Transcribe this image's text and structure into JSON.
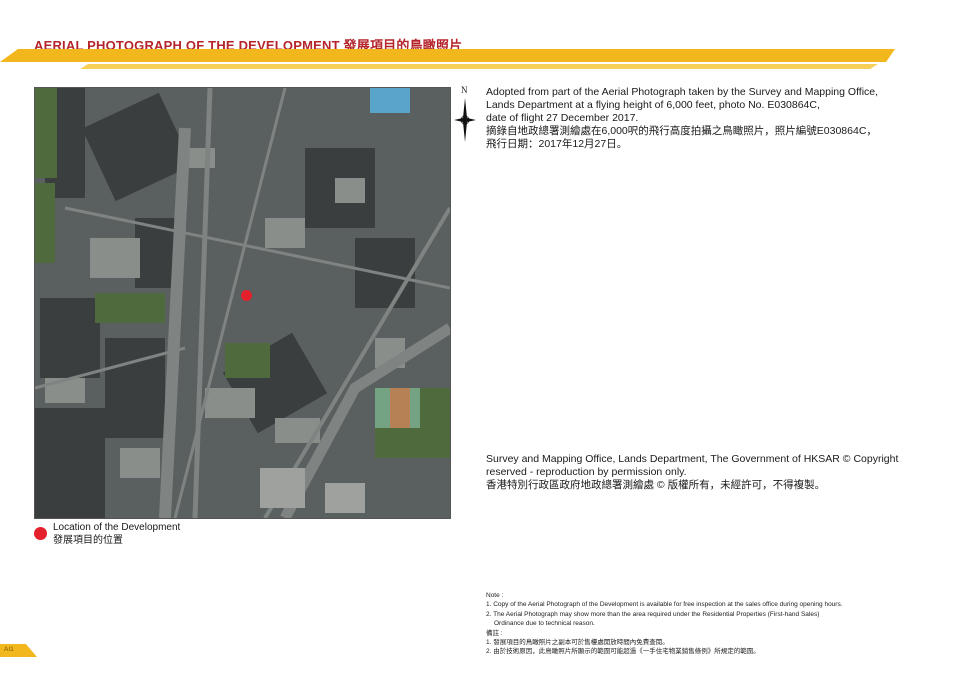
{
  "header": {
    "title": "AERIAL PHOTOGRAPH OF THE DEVELOPMENT 發展項目的鳥瞰照片"
  },
  "compass": {
    "label": "N"
  },
  "caption": {
    "lines": [
      "Adopted from part of the Aerial Photograph taken by the Survey and Mapping Office,",
      "Lands Department at a flying height of 6,000 feet, photo No. E030864C,",
      "date of flight 27 December 2017.",
      "摘錄自地政總署測繪處在6,000呎的飛行高度拍攝之鳥瞰照片，照片編號E030864C，",
      "飛行日期：2017年12月27日。"
    ]
  },
  "copyright": {
    "lines": [
      "Survey and Mapping Office, Lands Department, The Government of HKSAR © Copyright",
      "reserved - reproduction by permission only.",
      "香港特別行政區政府地政總署測繪處 © 版權所有，未經許可，不得複製。"
    ]
  },
  "legend": {
    "label_en": "Location of the Development",
    "label_zh": "發展項目的位置"
  },
  "notes": {
    "heading_en": "Note :",
    "items_en": [
      "1. Copy of the Aerial Photograph of the Development is available for free inspection at the sales office during opening hours.",
      "2. The Aerial Photograph may show more than the area required under the Residential Properties (First-hand Sales)",
      "Ordinance due to technical reason."
    ],
    "heading_zh": "備註 :",
    "items_zh": [
      "1. 發展項目的鳥瞰照片之副本可於售樓處開放時間內免費查閱。",
      "2. 由於技術原因，此鳥瞰照片所顯示的範圍可能超過《一手住宅物業銷售條例》所規定的範圍。"
    ]
  },
  "footer": {
    "page_number": "AI1"
  },
  "colors": {
    "title": "#b4252c",
    "band": "#f2b71c",
    "marker": "#e3202b"
  }
}
